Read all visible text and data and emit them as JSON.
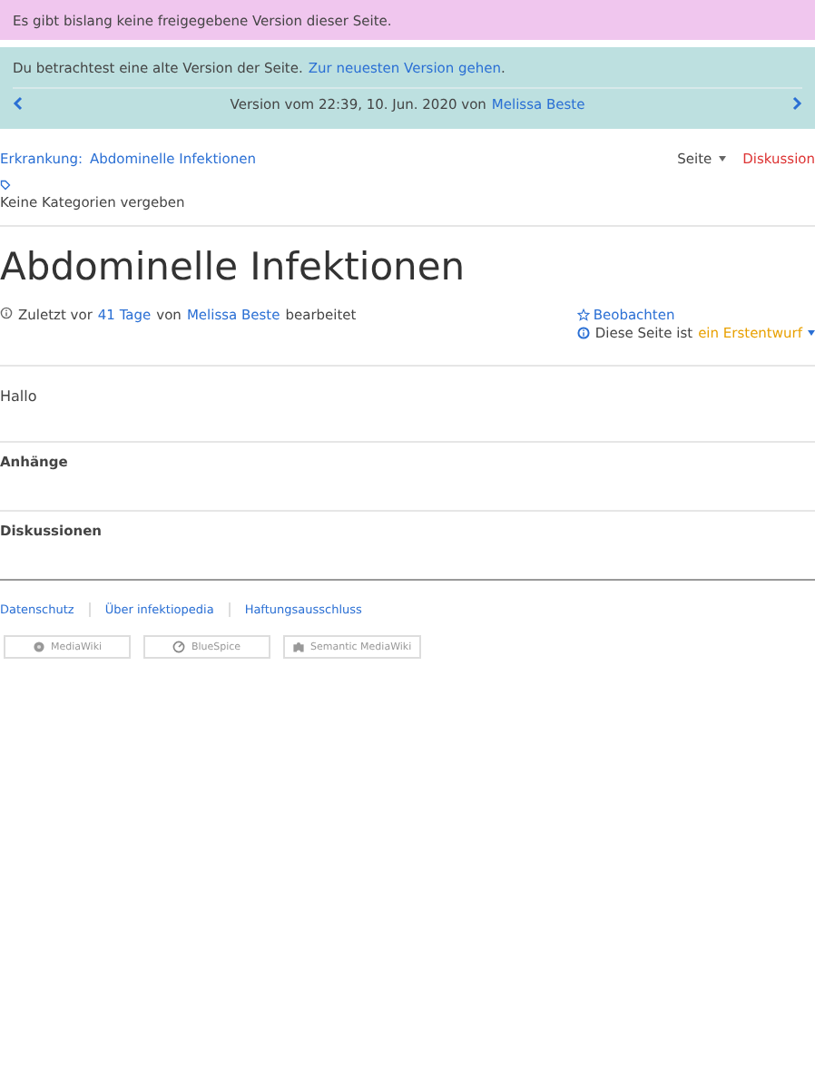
{
  "release_notice": {
    "text": "Es gibt bislang keine freigegebene Version dieser Seite."
  },
  "old_version_notice": {
    "text": "Du betrachtest eine alte Version der Seite.",
    "link": "Zur neuesten Version gehen",
    "after": ".",
    "version_label": "Version vom 22:39, 10. Jun. 2020 von",
    "version_author": "Melissa Beste"
  },
  "breadcrumb": {
    "label": "Erkrankung:",
    "page": "Abdominelle Infektionen"
  },
  "page_tabs": [
    {
      "label": "Seite",
      "kind": "dropdown"
    },
    {
      "label": "Diskussion",
      "kind": "link"
    }
  ],
  "categories": {
    "text": "Keine Kategorien vergeben"
  },
  "title": "Abdominelle Infektionen",
  "meta": {
    "before": "Zuletzt vor",
    "age": "41 Tage",
    "middle": "von",
    "author": "Melissa Beste",
    "after": "bearbeitet"
  },
  "watch": {
    "label": "Beobachten"
  },
  "status": {
    "text": "Diese Seite ist",
    "state": "ein Erstentwurf"
  },
  "content": "Hallo",
  "sections": [
    "Anhänge",
    "Diskussionen"
  ],
  "footer_links": [
    "Datenschutz",
    "Über infektiopedia",
    "Haftungsausschluss"
  ],
  "badges": [
    {
      "label": "MediaWiki",
      "kind": "gear"
    },
    {
      "label": "BlueSpice",
      "kind": "gauge"
    },
    {
      "label": "Semantic MediaWiki",
      "kind": "puzzle"
    }
  ]
}
